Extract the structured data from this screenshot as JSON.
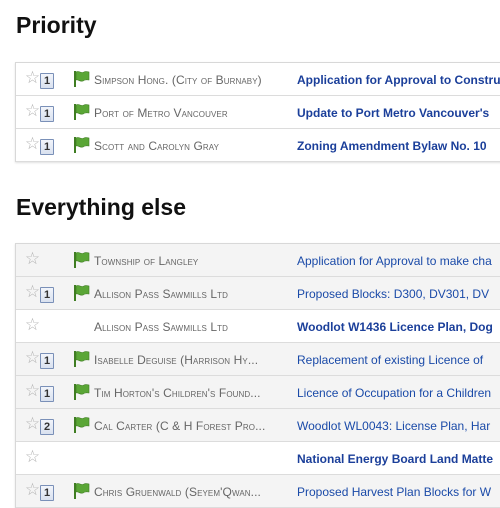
{
  "sections": [
    {
      "title": "Priority",
      "rows": [
        {
          "sender": "Simpson Hong. (City of Burnaby)",
          "subject": "Application for Approval to Construct",
          "count": "1",
          "flag": true,
          "bold": true
        },
        {
          "sender": "Port of Metro Vancouver",
          "subject": "Update to Port Metro Vancouver's",
          "count": "1",
          "flag": true,
          "bold": true
        },
        {
          "sender": "Scott and Carolyn Gray",
          "subject": "Zoning Amendment Bylaw No. 10",
          "count": "1",
          "flag": true,
          "bold": true
        }
      ]
    },
    {
      "title": "Everything else",
      "rows": [
        {
          "sender": "Township of Langley",
          "subject": "Application for Approval to make cha",
          "count": "",
          "flag": true,
          "bold": false
        },
        {
          "sender": "Allison Pass Sawmills Ltd",
          "subject": "Proposed Blocks: D300, DV301, DV",
          "count": "1",
          "flag": true,
          "bold": false
        },
        {
          "sender": "Allison Pass Sawmills Ltd",
          "subject": "Woodlot W1436 Licence Plan, Dog",
          "count": "",
          "flag": false,
          "bold": true
        },
        {
          "sender": "Isabelle Deguise (Harrison Hy...",
          "subject": "Replacement of existing Licence of",
          "count": "1",
          "flag": true,
          "bold": false
        },
        {
          "sender": "Tim Horton's Children's Found...",
          "subject": "Licence of Occupation for a Children",
          "count": "1",
          "flag": true,
          "bold": false
        },
        {
          "sender": "Cal Carter (C & H Forest Pro...",
          "subject": "Woodlot WL0043: License Plan, Har",
          "count": "2",
          "flag": true,
          "bold": false
        },
        {
          "sender": "",
          "subject": "National Energy Board Land Matte",
          "count": "",
          "flag": false,
          "bold": true
        },
        {
          "sender": "Chris Gruenwald (Seyem'Qwan...",
          "subject": "Proposed Harvest Plan Blocks for W",
          "count": "1",
          "flag": true,
          "bold": false
        }
      ]
    }
  ],
  "icons": {
    "star": "star-outline-icon",
    "flag": "green-flag-icon"
  },
  "colors": {
    "flag": "#5aa636",
    "subject_link": "#1a4aa8",
    "count_border": "#7a90b8"
  }
}
